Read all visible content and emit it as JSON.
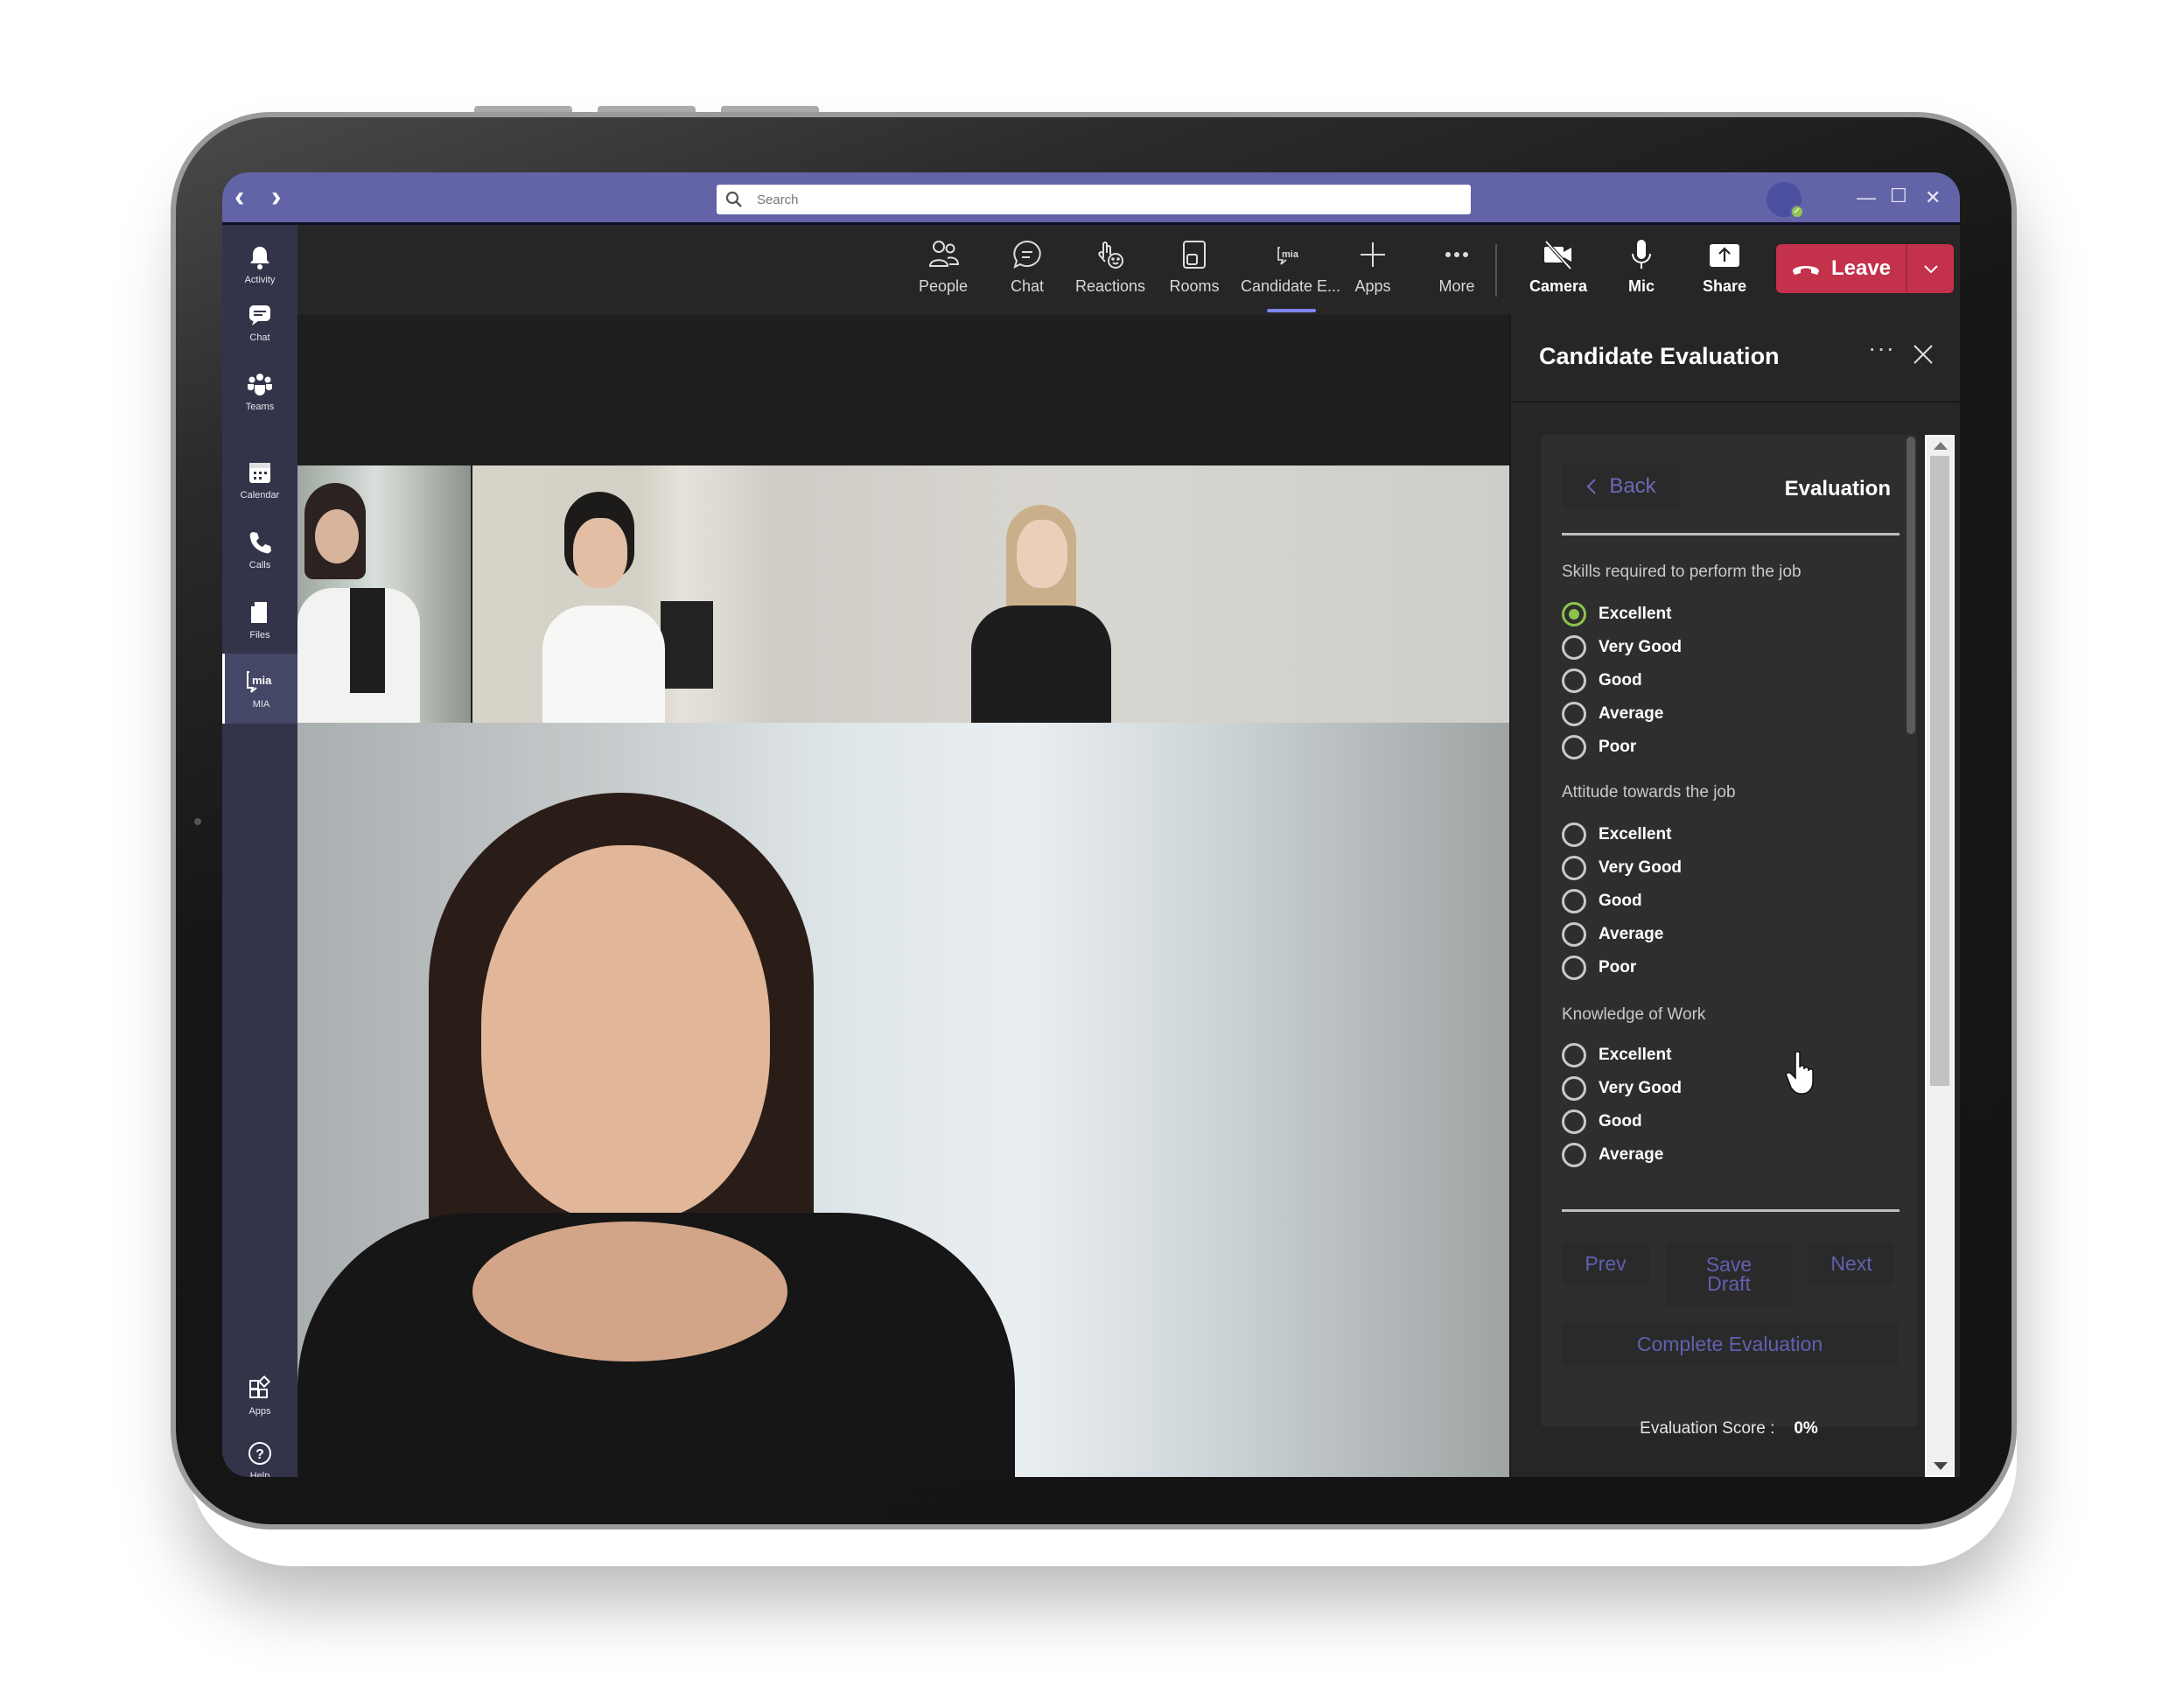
{
  "titlebar": {
    "back_icon": "chevron-left-icon",
    "forward_icon": "chevron-right-icon",
    "search_placeholder": "Search",
    "window_controls": [
      "minimize",
      "maximize",
      "close"
    ],
    "presence_status": "available",
    "color": "#6264a7"
  },
  "rail": {
    "items": [
      {
        "label": "Activity",
        "icon": "bell-icon"
      },
      {
        "label": "Chat",
        "icon": "chat-icon"
      },
      {
        "label": "Teams",
        "icon": "teams-icon"
      },
      {
        "label": "Calendar",
        "icon": "calendar-icon"
      },
      {
        "label": "Calls",
        "icon": "phone-icon"
      },
      {
        "label": "Files",
        "icon": "file-icon"
      },
      {
        "label": "MIA",
        "icon": "mia-icon",
        "active": true
      },
      {
        "label": "Apps",
        "icon": "apps-icon"
      },
      {
        "label": "Help",
        "icon": "help-icon"
      }
    ]
  },
  "toolbar": {
    "items": [
      {
        "label": "People",
        "icon": "people-icon"
      },
      {
        "label": "Chat",
        "icon": "chat-bubble-icon"
      },
      {
        "label": "Reactions",
        "icon": "reactions-icon"
      },
      {
        "label": "Rooms",
        "icon": "rooms-icon"
      },
      {
        "label": "Candidate E...",
        "icon": "mia-icon",
        "active": true
      },
      {
        "label": "Apps",
        "icon": "plus-icon"
      },
      {
        "label": "More",
        "icon": "more-icon"
      }
    ],
    "media": [
      {
        "label": "Camera",
        "icon": "camera-off-icon"
      },
      {
        "label": "Mic",
        "icon": "mic-icon"
      },
      {
        "label": "Share",
        "icon": "share-icon"
      }
    ],
    "leave_label": "Leave",
    "leave_color": "#c4314b",
    "active_underline_color": "#7f85f5"
  },
  "panel": {
    "title": "Candidate Evaluation",
    "back_label": "Back",
    "header_label": "Evaluation",
    "sections": [
      {
        "label": "Skills required to perform the job",
        "options": [
          "Excellent",
          "Very Good",
          "Good",
          "Average",
          "Poor"
        ],
        "selected": "Excellent"
      },
      {
        "label": "Attitude towards the job",
        "options": [
          "Excellent",
          "Very Good",
          "Good",
          "Average",
          "Poor"
        ],
        "selected": null
      },
      {
        "label": "Knowledge of Work",
        "options": [
          "Excellent",
          "Very Good",
          "Good",
          "Average"
        ],
        "selected": null
      }
    ],
    "prev_label": "Prev",
    "save_draft_label": "Save Draft",
    "next_label": "Next",
    "complete_label": "Complete Evaluation",
    "score_label": "Evaluation Score :",
    "score_value": "0%",
    "selected_color": "#8bc34a"
  },
  "participants": {
    "count": 4
  }
}
